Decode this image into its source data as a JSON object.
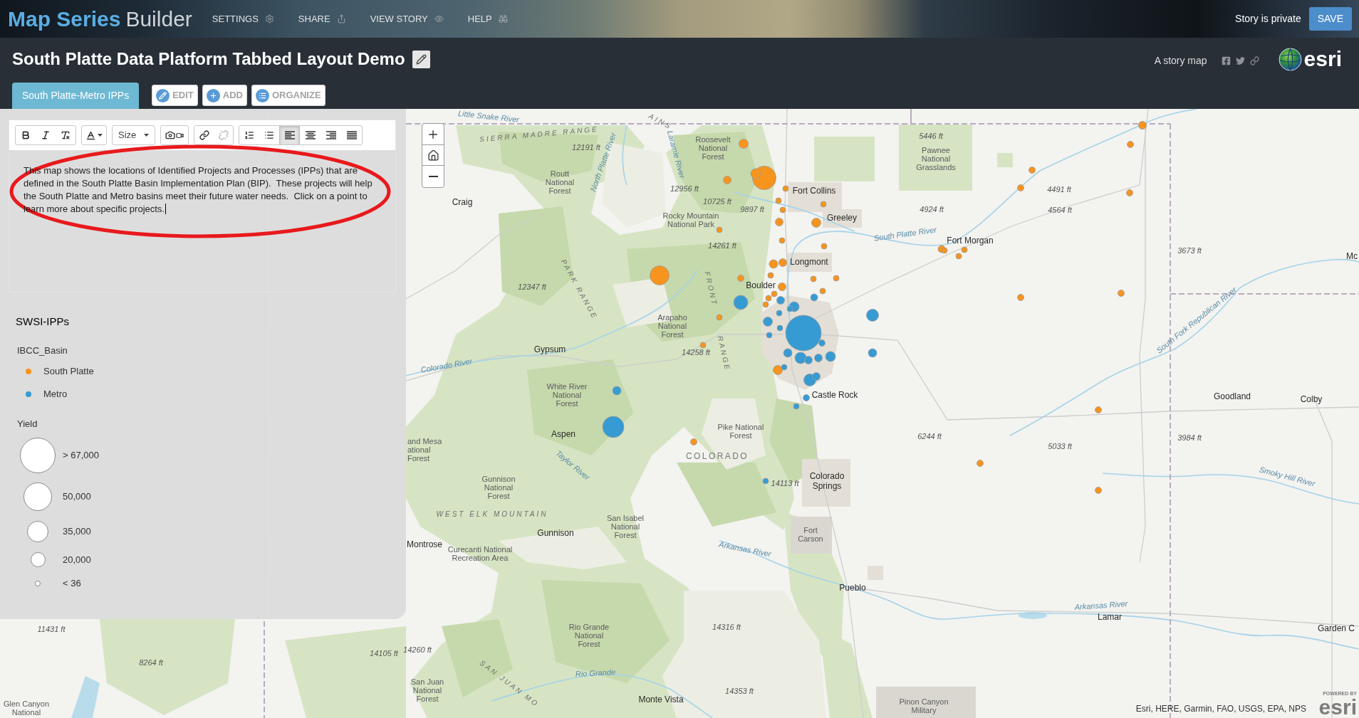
{
  "top_bar": {
    "app_title": {
      "bold": "Map Series",
      "light": "Builder"
    },
    "menu": [
      {
        "label": "SETTINGS"
      },
      {
        "label": "SHARE"
      },
      {
        "label": "VIEW STORY"
      },
      {
        "label": "HELP"
      }
    ],
    "privacy_status": "Story is private",
    "save_button": "SAVE"
  },
  "header": {
    "title": "South Platte Data Platform Tabbed Layout Demo",
    "tagline": "A story map",
    "logo_wordmark": "esri"
  },
  "tabs": [
    {
      "label": "South Platte-Metro IPPs",
      "selected": true
    }
  ],
  "tab_actions": [
    {
      "label": "EDIT"
    },
    {
      "label": "ADD"
    },
    {
      "label": "ORGANIZE"
    }
  ],
  "editor": {
    "toolbar": {
      "size_dropdown": "Size",
      "link_buttons": [
        {
          "disabled": false
        },
        {
          "disabled": true
        }
      ],
      "alignment_buttons": [
        {
          "selected": true
        },
        {
          "selected": false
        },
        {
          "selected": false
        },
        {
          "selected": false
        }
      ]
    },
    "text": "This map shows the locations of Identified Projects and Processes (IPPs) that are defined in the South Platte Basin Implementation Plan (BIP).  These projects will help the South Platte and Metro basins meet their future water needs.  Click on a point to learn more about specific projects.",
    "focused": true
  },
  "legend": {
    "title": "SWSI-IPPs",
    "color_field": "IBCC_Basin",
    "categories": [
      {
        "label": "South Platte",
        "color": "#f7941d"
      },
      {
        "label": "Metro",
        "color": "#379bd3"
      }
    ],
    "size_field": "Yield",
    "size_classes": [
      {
        "label": "> 67,000"
      },
      {
        "label": "50,000"
      },
      {
        "label": "35,000"
      },
      {
        "label": "20,000"
      },
      {
        "label": "< 36"
      }
    ]
  },
  "map": {
    "labels": [
      {
        "kind": "water",
        "text": "Little Snake River"
      },
      {
        "kind": "range",
        "text": "AINS"
      },
      {
        "kind": "range",
        "text": "SIERRA MADRE RANGE"
      },
      {
        "kind": "elevation",
        "text": "5446 ft"
      },
      {
        "kind": "elevation",
        "text": "12191 ft"
      },
      {
        "kind": "area",
        "lines": [
          "Roosevelt",
          "National",
          "Forest"
        ]
      },
      {
        "kind": "water",
        "text": "Laramie River"
      },
      {
        "kind": "water",
        "text": "North Platte River"
      },
      {
        "kind": "area",
        "lines": [
          "Pawnee",
          "National",
          "Grasslands"
        ]
      },
      {
        "kind": "area",
        "lines": [
          "Routt",
          "National",
          "Forest"
        ]
      },
      {
        "kind": "elevation",
        "text": "12956 ft"
      },
      {
        "kind": "city",
        "text": "Fort Collins"
      },
      {
        "kind": "elevation",
        "text": "4491 ft"
      },
      {
        "kind": "city",
        "text": "Craig"
      },
      {
        "kind": "elevation",
        "text": "10725 ft"
      },
      {
        "kind": "elevation",
        "text": "9897 ft"
      },
      {
        "kind": "elevation",
        "text": "4924 ft"
      },
      {
        "kind": "elevation",
        "text": "4564 ft"
      },
      {
        "kind": "area",
        "lines": [
          "Rocky Mountain",
          "National Park"
        ]
      },
      {
        "kind": "city",
        "text": "Greeley"
      },
      {
        "kind": "water",
        "text": "South Platte River"
      },
      {
        "kind": "city",
        "text": "Fort Morgan"
      },
      {
        "kind": "elevation",
        "text": "14261 ft"
      },
      {
        "kind": "elevation",
        "text": "3673 ft"
      },
      {
        "kind": "city",
        "text": "Mc"
      },
      {
        "kind": "city",
        "text": "Longmont"
      },
      {
        "kind": "elevation",
        "text": "12347 ft"
      },
      {
        "kind": "range",
        "text": "PARK RANGE"
      },
      {
        "kind": "range",
        "text": "FRONT"
      },
      {
        "kind": "city",
        "text": "Boulder"
      },
      {
        "kind": "water",
        "text": "South Fork Republican River"
      },
      {
        "kind": "area",
        "lines": [
          "Arapaho",
          "National",
          "Forest"
        ]
      },
      {
        "kind": "city",
        "text": "Gypsum"
      },
      {
        "kind": "elevation",
        "text": "14258 ft"
      },
      {
        "kind": "range",
        "text": "RANGE"
      },
      {
        "kind": "water",
        "text": "Colorado River"
      },
      {
        "kind": "area",
        "lines": [
          "White River",
          "National",
          "Forest"
        ]
      },
      {
        "kind": "city",
        "text": "Castle Rock"
      },
      {
        "kind": "city",
        "text": "Goodland"
      },
      {
        "kind": "city",
        "text": "Colby"
      },
      {
        "kind": "city",
        "text": "Aspen"
      },
      {
        "kind": "area",
        "lines": [
          "Pike National",
          "Forest"
        ]
      },
      {
        "kind": "elevation",
        "text": "6244 ft"
      },
      {
        "kind": "elevation",
        "text": "3984 ft"
      },
      {
        "kind": "elevation",
        "text": "5033 ft"
      },
      {
        "kind": "area",
        "lines": [
          "and Mesa",
          "ational",
          "Forest"
        ]
      },
      {
        "kind": "state",
        "text": "COLORADO"
      },
      {
        "kind": "water",
        "text": "Taylor River"
      },
      {
        "kind": "water",
        "text": "Smoky Hill River"
      },
      {
        "kind": "area",
        "lines": [
          "Gunnison",
          "National",
          "Forest"
        ]
      },
      {
        "kind": "elevation",
        "text": "14113 ft"
      },
      {
        "kind": "city",
        "lines": [
          "Colorado",
          "Springs"
        ]
      },
      {
        "kind": "range",
        "text": "WEST ELK MOUNTAIN"
      },
      {
        "kind": "city",
        "text": "Gunnison"
      },
      {
        "kind": "area",
        "lines": [
          "San Isabel",
          "National",
          "Forest"
        ]
      },
      {
        "kind": "area",
        "lines": [
          "Fort",
          "Carson"
        ]
      },
      {
        "kind": "city",
        "text": "Montrose"
      },
      {
        "kind": "area",
        "lines": [
          "Curecanti National",
          "Recreation Area"
        ]
      },
      {
        "kind": "water",
        "text": "Arkansas River"
      },
      {
        "kind": "city",
        "text": "Pueblo"
      },
      {
        "kind": "water",
        "text": "Arkansas River"
      },
      {
        "kind": "city",
        "text": "Lamar"
      },
      {
        "kind": "elevation",
        "text": "11431 ft"
      },
      {
        "kind": "area",
        "lines": [
          "Rio Grande",
          "National",
          "Forest"
        ]
      },
      {
        "kind": "elevation",
        "text": "14316 ft"
      },
      {
        "kind": "city",
        "text": "Garden C"
      },
      {
        "kind": "elevation",
        "text": "14105 ft"
      },
      {
        "kind": "elevation",
        "text": "14260 ft"
      },
      {
        "kind": "elevation",
        "text": "8264 ft"
      },
      {
        "kind": "water",
        "text": "Rio Grande"
      },
      {
        "kind": "area",
        "lines": [
          "San Juan",
          "National",
          "Forest"
        ]
      },
      {
        "kind": "range",
        "text": "SAN JUAN MO"
      },
      {
        "kind": "elevation",
        "text": "14353 ft"
      },
      {
        "kind": "city",
        "text": "Monte Vista"
      },
      {
        "kind": "area",
        "lines": [
          "Glen Canyon",
          "National"
        ]
      },
      {
        "kind": "area",
        "lines": [
          "Pinon Canyon",
          "Military"
        ]
      }
    ],
    "points": [
      {
        "color": "#f7941d"
      },
      {
        "color": "#f7941d"
      },
      {
        "color": "#f7941d"
      },
      {
        "color": "#f7941d"
      },
      {
        "color": "#f7941d"
      },
      {
        "color": "#f7941d"
      },
      {
        "color": "#f7941d"
      },
      {
        "color": "#f7941d"
      },
      {
        "color": "#f7941d"
      },
      {
        "color": "#f7941d"
      },
      {
        "color": "#f7941d"
      },
      {
        "color": "#f7941d"
      },
      {
        "color": "#f7941d"
      },
      {
        "color": "#f7941d"
      },
      {
        "color": "#f7941d"
      },
      {
        "color": "#f7941d"
      },
      {
        "color": "#f7941d"
      },
      {
        "color": "#f7941d"
      },
      {
        "color": "#f7941d"
      },
      {
        "color": "#f7941d"
      },
      {
        "color": "#f7941d"
      },
      {
        "color": "#f7941d"
      },
      {
        "color": "#f7941d"
      },
      {
        "color": "#f7941d"
      },
      {
        "color": "#f7941d"
      },
      {
        "color": "#f7941d"
      },
      {
        "color": "#f7941d"
      },
      {
        "color": "#f7941d"
      },
      {
        "color": "#f7941d"
      },
      {
        "color": "#f7941d"
      },
      {
        "color": "#f7941d"
      },
      {
        "color": "#f7941d"
      },
      {
        "color": "#f7941d"
      },
      {
        "color": "#f7941d"
      },
      {
        "color": "#f7941d"
      },
      {
        "color": "#f7941d"
      },
      {
        "color": "#f7941d"
      },
      {
        "color": "#f7941d"
      },
      {
        "color": "#f7941d"
      },
      {
        "color": "#f7941d"
      },
      {
        "color": "#f7941d"
      },
      {
        "color": "#f7941d"
      },
      {
        "color": "#f7941d"
      },
      {
        "color": "#379bd3"
      },
      {
        "color": "#379bd3"
      },
      {
        "color": "#379bd3"
      },
      {
        "color": "#379bd3"
      },
      {
        "color": "#379bd3"
      },
      {
        "color": "#379bd3"
      },
      {
        "color": "#379bd3"
      },
      {
        "color": "#379bd3"
      },
      {
        "color": "#379bd3"
      },
      {
        "color": "#379bd3"
      },
      {
        "color": "#379bd3"
      },
      {
        "color": "#379bd3"
      },
      {
        "color": "#379bd3"
      },
      {
        "color": "#379bd3"
      },
      {
        "color": "#379bd3"
      },
      {
        "color": "#379bd3"
      },
      {
        "color": "#379bd3"
      },
      {
        "color": "#379bd3"
      },
      {
        "color": "#379bd3"
      },
      {
        "color": "#379bd3"
      },
      {
        "color": "#379bd3"
      },
      {
        "color": "#379bd3"
      },
      {
        "color": "#379bd3"
      },
      {
        "color": "#379bd3"
      },
      {
        "color": "#379bd3"
      },
      {
        "color": "#379bd3"
      }
    ],
    "attribution": "Esri, HERE, Garmin, FAO, USGS, EPA, NPS",
    "powered_by": {
      "caption": "POWERED BY",
      "wordmark": "esri"
    }
  }
}
